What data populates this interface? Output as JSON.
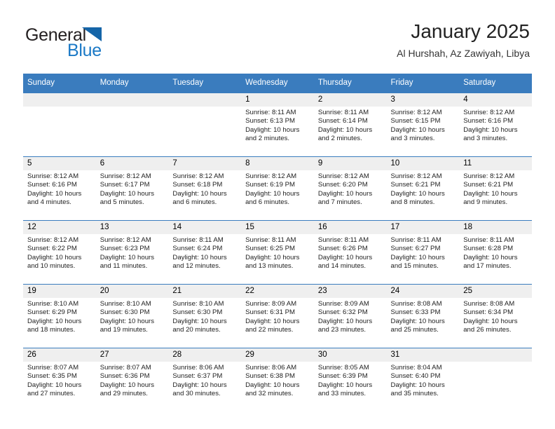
{
  "brand": {
    "name_top": "General",
    "name_bottom": "Blue",
    "accent_color": "#1b79c6",
    "triangle_color": "#1565a8"
  },
  "header": {
    "title": "January 2025",
    "subtitle": "Al Hurshah, Az Zawiyah, Libya",
    "header_bg_color": "#3a7cbe",
    "daynum_bg_color": "#efefef"
  },
  "weekdays": [
    "Sunday",
    "Monday",
    "Tuesday",
    "Wednesday",
    "Thursday",
    "Friday",
    "Saturday"
  ],
  "weeks": [
    [
      {
        "day": "",
        "blank": true,
        "sunrise": "",
        "sunset": "",
        "daylight_line1": "",
        "daylight_line2": ""
      },
      {
        "day": "",
        "blank": true,
        "sunrise": "",
        "sunset": "",
        "daylight_line1": "",
        "daylight_line2": ""
      },
      {
        "day": "",
        "blank": true,
        "sunrise": "",
        "sunset": "",
        "daylight_line1": "",
        "daylight_line2": ""
      },
      {
        "day": "1",
        "blank": false,
        "sunrise": "Sunrise: 8:11 AM",
        "sunset": "Sunset: 6:13 PM",
        "daylight_line1": "Daylight: 10 hours",
        "daylight_line2": "and 2 minutes."
      },
      {
        "day": "2",
        "blank": false,
        "sunrise": "Sunrise: 8:11 AM",
        "sunset": "Sunset: 6:14 PM",
        "daylight_line1": "Daylight: 10 hours",
        "daylight_line2": "and 2 minutes."
      },
      {
        "day": "3",
        "blank": false,
        "sunrise": "Sunrise: 8:12 AM",
        "sunset": "Sunset: 6:15 PM",
        "daylight_line1": "Daylight: 10 hours",
        "daylight_line2": "and 3 minutes."
      },
      {
        "day": "4",
        "blank": false,
        "sunrise": "Sunrise: 8:12 AM",
        "sunset": "Sunset: 6:16 PM",
        "daylight_line1": "Daylight: 10 hours",
        "daylight_line2": "and 3 minutes."
      }
    ],
    [
      {
        "day": "5",
        "blank": false,
        "sunrise": "Sunrise: 8:12 AM",
        "sunset": "Sunset: 6:16 PM",
        "daylight_line1": "Daylight: 10 hours",
        "daylight_line2": "and 4 minutes."
      },
      {
        "day": "6",
        "blank": false,
        "sunrise": "Sunrise: 8:12 AM",
        "sunset": "Sunset: 6:17 PM",
        "daylight_line1": "Daylight: 10 hours",
        "daylight_line2": "and 5 minutes."
      },
      {
        "day": "7",
        "blank": false,
        "sunrise": "Sunrise: 8:12 AM",
        "sunset": "Sunset: 6:18 PM",
        "daylight_line1": "Daylight: 10 hours",
        "daylight_line2": "and 6 minutes."
      },
      {
        "day": "8",
        "blank": false,
        "sunrise": "Sunrise: 8:12 AM",
        "sunset": "Sunset: 6:19 PM",
        "daylight_line1": "Daylight: 10 hours",
        "daylight_line2": "and 6 minutes."
      },
      {
        "day": "9",
        "blank": false,
        "sunrise": "Sunrise: 8:12 AM",
        "sunset": "Sunset: 6:20 PM",
        "daylight_line1": "Daylight: 10 hours",
        "daylight_line2": "and 7 minutes."
      },
      {
        "day": "10",
        "blank": false,
        "sunrise": "Sunrise: 8:12 AM",
        "sunset": "Sunset: 6:21 PM",
        "daylight_line1": "Daylight: 10 hours",
        "daylight_line2": "and 8 minutes."
      },
      {
        "day": "11",
        "blank": false,
        "sunrise": "Sunrise: 8:12 AM",
        "sunset": "Sunset: 6:21 PM",
        "daylight_line1": "Daylight: 10 hours",
        "daylight_line2": "and 9 minutes."
      }
    ],
    [
      {
        "day": "12",
        "blank": false,
        "sunrise": "Sunrise: 8:12 AM",
        "sunset": "Sunset: 6:22 PM",
        "daylight_line1": "Daylight: 10 hours",
        "daylight_line2": "and 10 minutes."
      },
      {
        "day": "13",
        "blank": false,
        "sunrise": "Sunrise: 8:12 AM",
        "sunset": "Sunset: 6:23 PM",
        "daylight_line1": "Daylight: 10 hours",
        "daylight_line2": "and 11 minutes."
      },
      {
        "day": "14",
        "blank": false,
        "sunrise": "Sunrise: 8:11 AM",
        "sunset": "Sunset: 6:24 PM",
        "daylight_line1": "Daylight: 10 hours",
        "daylight_line2": "and 12 minutes."
      },
      {
        "day": "15",
        "blank": false,
        "sunrise": "Sunrise: 8:11 AM",
        "sunset": "Sunset: 6:25 PM",
        "daylight_line1": "Daylight: 10 hours",
        "daylight_line2": "and 13 minutes."
      },
      {
        "day": "16",
        "blank": false,
        "sunrise": "Sunrise: 8:11 AM",
        "sunset": "Sunset: 6:26 PM",
        "daylight_line1": "Daylight: 10 hours",
        "daylight_line2": "and 14 minutes."
      },
      {
        "day": "17",
        "blank": false,
        "sunrise": "Sunrise: 8:11 AM",
        "sunset": "Sunset: 6:27 PM",
        "daylight_line1": "Daylight: 10 hours",
        "daylight_line2": "and 15 minutes."
      },
      {
        "day": "18",
        "blank": false,
        "sunrise": "Sunrise: 8:11 AM",
        "sunset": "Sunset: 6:28 PM",
        "daylight_line1": "Daylight: 10 hours",
        "daylight_line2": "and 17 minutes."
      }
    ],
    [
      {
        "day": "19",
        "blank": false,
        "sunrise": "Sunrise: 8:10 AM",
        "sunset": "Sunset: 6:29 PM",
        "daylight_line1": "Daylight: 10 hours",
        "daylight_line2": "and 18 minutes."
      },
      {
        "day": "20",
        "blank": false,
        "sunrise": "Sunrise: 8:10 AM",
        "sunset": "Sunset: 6:30 PM",
        "daylight_line1": "Daylight: 10 hours",
        "daylight_line2": "and 19 minutes."
      },
      {
        "day": "21",
        "blank": false,
        "sunrise": "Sunrise: 8:10 AM",
        "sunset": "Sunset: 6:30 PM",
        "daylight_line1": "Daylight: 10 hours",
        "daylight_line2": "and 20 minutes."
      },
      {
        "day": "22",
        "blank": false,
        "sunrise": "Sunrise: 8:09 AM",
        "sunset": "Sunset: 6:31 PM",
        "daylight_line1": "Daylight: 10 hours",
        "daylight_line2": "and 22 minutes."
      },
      {
        "day": "23",
        "blank": false,
        "sunrise": "Sunrise: 8:09 AM",
        "sunset": "Sunset: 6:32 PM",
        "daylight_line1": "Daylight: 10 hours",
        "daylight_line2": "and 23 minutes."
      },
      {
        "day": "24",
        "blank": false,
        "sunrise": "Sunrise: 8:08 AM",
        "sunset": "Sunset: 6:33 PM",
        "daylight_line1": "Daylight: 10 hours",
        "daylight_line2": "and 25 minutes."
      },
      {
        "day": "25",
        "blank": false,
        "sunrise": "Sunrise: 8:08 AM",
        "sunset": "Sunset: 6:34 PM",
        "daylight_line1": "Daylight: 10 hours",
        "daylight_line2": "and 26 minutes."
      }
    ],
    [
      {
        "day": "26",
        "blank": false,
        "sunrise": "Sunrise: 8:07 AM",
        "sunset": "Sunset: 6:35 PM",
        "daylight_line1": "Daylight: 10 hours",
        "daylight_line2": "and 27 minutes."
      },
      {
        "day": "27",
        "blank": false,
        "sunrise": "Sunrise: 8:07 AM",
        "sunset": "Sunset: 6:36 PM",
        "daylight_line1": "Daylight: 10 hours",
        "daylight_line2": "and 29 minutes."
      },
      {
        "day": "28",
        "blank": false,
        "sunrise": "Sunrise: 8:06 AM",
        "sunset": "Sunset: 6:37 PM",
        "daylight_line1": "Daylight: 10 hours",
        "daylight_line2": "and 30 minutes."
      },
      {
        "day": "29",
        "blank": false,
        "sunrise": "Sunrise: 8:06 AM",
        "sunset": "Sunset: 6:38 PM",
        "daylight_line1": "Daylight: 10 hours",
        "daylight_line2": "and 32 minutes."
      },
      {
        "day": "30",
        "blank": false,
        "sunrise": "Sunrise: 8:05 AM",
        "sunset": "Sunset: 6:39 PM",
        "daylight_line1": "Daylight: 10 hours",
        "daylight_line2": "and 33 minutes."
      },
      {
        "day": "31",
        "blank": false,
        "sunrise": "Sunrise: 8:04 AM",
        "sunset": "Sunset: 6:40 PM",
        "daylight_line1": "Daylight: 10 hours",
        "daylight_line2": "and 35 minutes."
      },
      {
        "day": "",
        "blank": true,
        "sunrise": "",
        "sunset": "",
        "daylight_line1": "",
        "daylight_line2": ""
      }
    ]
  ]
}
